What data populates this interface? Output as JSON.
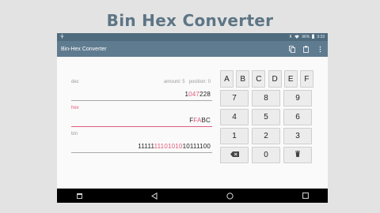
{
  "banner": {
    "title": "Bin Hex Converter"
  },
  "status_bar": {
    "left_icon": "usb-icon",
    "battery_text": "96%",
    "time": "3:33"
  },
  "app_bar": {
    "title": "Bin-Hex Converter",
    "actions": [
      "copy-icon",
      "paste-icon",
      "more-vert-icon"
    ]
  },
  "fields": {
    "dec": {
      "label": "dec",
      "amount_label": "amount:",
      "amount": "5",
      "position_label": "position:",
      "position": "0",
      "value_plain": "1",
      "value_hl": "047",
      "value_tail": "228"
    },
    "hex": {
      "label": "hex",
      "value_plain": "F",
      "value_hl": "FA",
      "value_tail": "BC"
    },
    "bin": {
      "label": "bin",
      "value_plain": "11111",
      "value_hl": "11101010",
      "value_tail": "10111100"
    }
  },
  "keypad": {
    "hex_keys": [
      "A",
      "B",
      "C",
      "D",
      "E",
      "F"
    ],
    "rows": [
      [
        "7",
        "8",
        "9"
      ],
      [
        "4",
        "5",
        "6"
      ],
      [
        "1",
        "2",
        "3"
      ]
    ],
    "zero": "0",
    "backspace_icon": "backspace-icon",
    "clear_icon": "delete-icon"
  },
  "nav_bar": {
    "icons": [
      "menu-icon",
      "back-icon",
      "home-icon",
      "recents-icon"
    ]
  },
  "colors": {
    "accent": "#e05c7c",
    "app_bar": "#5f7b8f",
    "status_bar": "#4f6b7e",
    "title": "#5d7585"
  }
}
